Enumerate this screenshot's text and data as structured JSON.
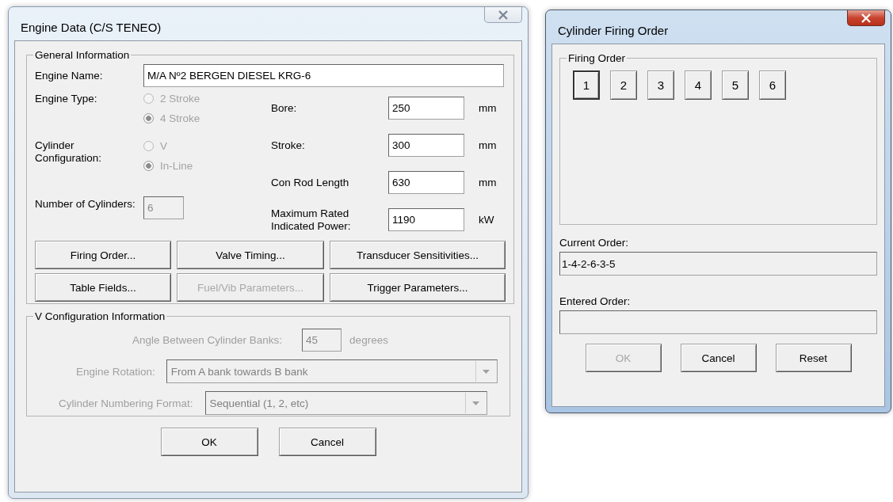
{
  "engine_window": {
    "title": "Engine Data (C/S TENEO)",
    "active": false,
    "general_information": {
      "title": "General Information",
      "engine_name": {
        "label": "Engine Name:",
        "value": "M/A Nº2 BERGEN DIESEL KRG-6"
      },
      "engine_type": {
        "label": "Engine Type:",
        "options": [
          {
            "label": "2 Stroke",
            "selected": false,
            "disabled": true
          },
          {
            "label": "4 Stroke",
            "selected": true,
            "disabled": true
          }
        ]
      },
      "cylinder_configuration": {
        "label": "Cylinder Configuration:",
        "options": [
          {
            "label": "V",
            "selected": false,
            "disabled": true
          },
          {
            "label": "In-Line",
            "selected": true,
            "disabled": true
          }
        ]
      },
      "number_of_cylinders": {
        "label": "Number of Cylinders:",
        "value": "6",
        "disabled": true
      },
      "measurements": [
        {
          "label": "Bore:",
          "value": "250",
          "unit": "mm"
        },
        {
          "label": "Stroke:",
          "value": "300",
          "unit": "mm"
        },
        {
          "label": "Con Rod Length",
          "value": "630",
          "unit": "mm"
        },
        {
          "label": "Maximum Rated Indicated Power:",
          "value": "1190",
          "unit": "kW"
        }
      ],
      "buttons": [
        {
          "label": "Firing Order...",
          "disabled": false
        },
        {
          "label": "Valve Timing...",
          "disabled": false
        },
        {
          "label": "Transducer Sensitivities...",
          "disabled": false
        },
        {
          "label": "Table Fields...",
          "disabled": false
        },
        {
          "label": "Fuel/Vib Parameters...",
          "disabled": true
        },
        {
          "label": "Trigger Parameters...",
          "disabled": false
        }
      ]
    },
    "v_configuration": {
      "title": "V Configuration Information",
      "disabled": true,
      "angle": {
        "label": "Angle Between Cylinder Banks:",
        "value": "45",
        "unit": "degrees"
      },
      "engine_rotation": {
        "label": "Engine Rotation:",
        "value": "From A bank towards B bank"
      },
      "numbering_format": {
        "label": "Cylinder Numbering Format:",
        "value": "Sequential (1, 2, etc)"
      }
    },
    "buttons": [
      {
        "label": "OK",
        "disabled": false
      },
      {
        "label": "Cancel",
        "disabled": false
      }
    ]
  },
  "firing_window": {
    "title": "Cylinder Firing Order",
    "active": true,
    "firing_order": {
      "title": "Firing Order",
      "cylinders": [
        {
          "label": "1",
          "selected": true
        },
        {
          "label": "2",
          "selected": false
        },
        {
          "label": "3",
          "selected": false
        },
        {
          "label": "4",
          "selected": false
        },
        {
          "label": "5",
          "selected": false
        },
        {
          "label": "6",
          "selected": false
        }
      ]
    },
    "current_order": {
      "label": "Current Order:",
      "value": "1-4-2-6-3-5"
    },
    "entered_order": {
      "label": "Entered Order:"
    },
    "buttons": [
      {
        "label": "OK",
        "disabled": true
      },
      {
        "label": "Cancel",
        "disabled": false
      },
      {
        "label": "Reset",
        "disabled": false
      }
    ]
  }
}
